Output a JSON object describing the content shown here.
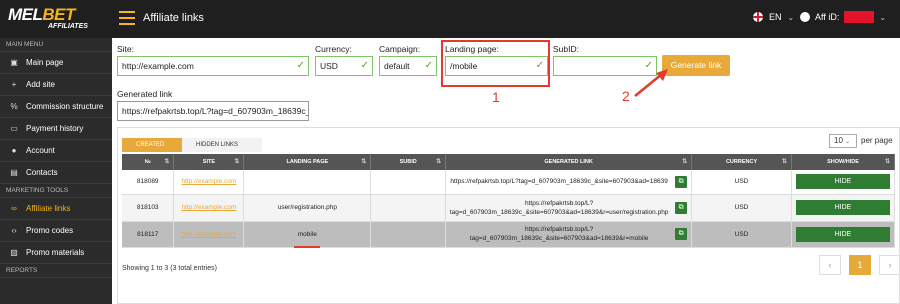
{
  "header": {
    "logo_main_a": "MEL",
    "logo_main_b": "BET",
    "logo_sub": "AFFILIATES",
    "title": "Affiliate links",
    "lang": "EN",
    "user_label": "Aff iD:"
  },
  "sidebar": {
    "sections": [
      "MAIN MENU",
      "MARKETING TOOLS",
      "REPORTS"
    ],
    "items": [
      {
        "label": "Main page",
        "icon": "dashboard-icon",
        "glyph": "▣"
      },
      {
        "label": "Add site",
        "icon": "plus-icon",
        "glyph": "+"
      },
      {
        "label": "Commission structure",
        "icon": "percent-icon",
        "glyph": "%"
      },
      {
        "label": "Payment history",
        "icon": "card-icon",
        "glyph": "▭"
      },
      {
        "label": "Account",
        "icon": "user-icon",
        "glyph": "●"
      },
      {
        "label": "Contacts",
        "icon": "contacts-icon",
        "glyph": "▤"
      },
      {
        "label": "Affiliate links",
        "icon": "link-icon",
        "glyph": "∞"
      },
      {
        "label": "Promo codes",
        "icon": "code-icon",
        "glyph": "‹›"
      },
      {
        "label": "Promo materials",
        "icon": "image-icon",
        "glyph": "▨"
      }
    ]
  },
  "form": {
    "site_label": "Site:",
    "site_value": "http://example.com",
    "currency_label": "Currency:",
    "currency_value": "USD",
    "campaign_label": "Campaign:",
    "campaign_value": "default",
    "landing_label": "Landing page:",
    "landing_value": "/mobile",
    "subid_label": "SubID:",
    "subid_value": "",
    "generate_label": "Generate link",
    "generated_label": "Generated link",
    "generated_value": "https://refpakrtsb.top/L?tag=d_607903m_18639c_"
  },
  "annotations": {
    "one": "1",
    "two": "2"
  },
  "table": {
    "tab_created": "CREATED LINKS",
    "tab_hidden": "HIDDEN LINKS",
    "page_size": "10",
    "per_page": "per page",
    "columns": [
      "№",
      "SITE",
      "LANDING PAGE",
      "SUBID",
      "GENERATED LINK",
      "CURRENCY",
      "SHOW/HIDE"
    ],
    "rows": [
      {
        "id": "818089",
        "site": "http://example.com",
        "landing": "",
        "subid": "",
        "link": "https://refpakrtsb.top/L?tag=d_607903m_18639c_&site=607903&ad=18639",
        "currency": "USD",
        "action": "HIDE"
      },
      {
        "id": "818103",
        "site": "http://example.com",
        "landing": "user/registration.php",
        "subid": "",
        "link_a": "https://refpakrtsb.top/L?",
        "link_b": "tag=d_607903m_18639c_&site=607903&ad=18639&r=user/registration.php",
        "currency": "USD",
        "action": "HIDE"
      },
      {
        "id": "818117",
        "site": "http://example.com",
        "landing": "mobile",
        "subid": "",
        "link_a": "https://refpakrtsb.top/L?",
        "link_b": "tag=d_607903m_18639c_&site=607903&ad=18639&r=mobile",
        "currency": "USD",
        "action": "HIDE"
      }
    ],
    "showing": "Showing 1 to 3 (3 total entries)",
    "prev": "‹",
    "current_page": "1",
    "next": "›"
  },
  "colors": {
    "accent": "#e6a93a",
    "success": "#2f7d32",
    "annotation": "#e23a2e",
    "sidebar": "#2b2b2b"
  }
}
